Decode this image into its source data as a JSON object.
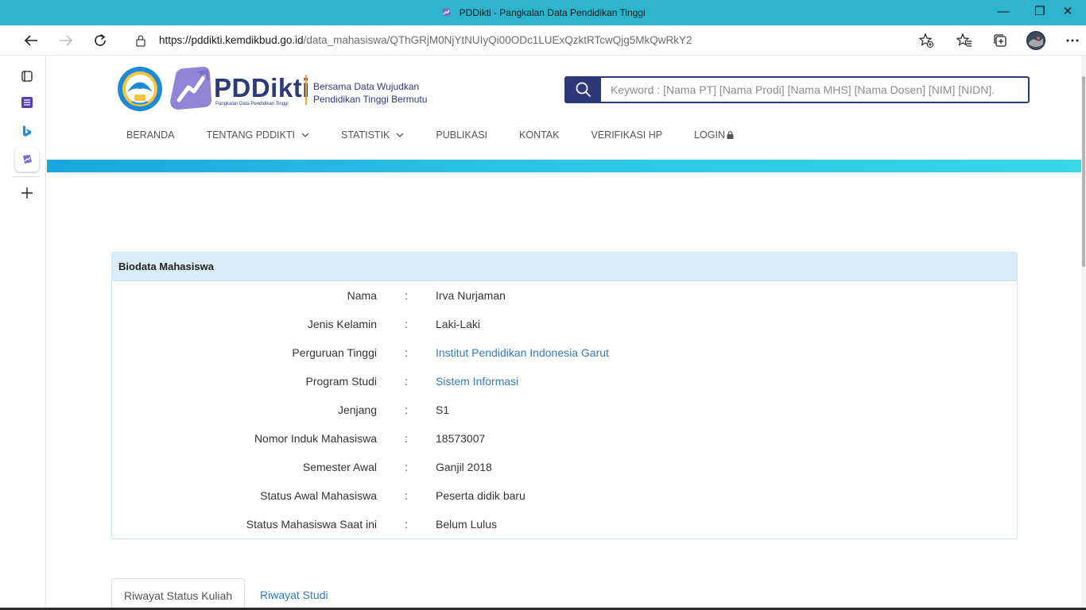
{
  "window": {
    "title": "PDDikti - Pangkalan Data Pendidikan Tinggi",
    "controls": {
      "minimize": "—",
      "restore": "❐",
      "close": "✕"
    }
  },
  "browser": {
    "url_host": "https://pddikti.kemdikbud.go.id",
    "url_path": "/data_mahasiswa/QThGRjM0NjYtNUIyQi00ODc1LUExQzktRTcwQjg5MkQwRkY2",
    "icons": [
      "back-icon",
      "forward-icon",
      "refresh-icon",
      "lock-icon",
      "add-favorite-icon",
      "favorites-icon",
      "collections-icon",
      "profile-avatar",
      "more-icon"
    ]
  },
  "sidebar": {
    "icons": [
      "tabs-icon",
      "list-app-icon",
      "bing-icon",
      "pddikti-app-icon",
      "add-icon"
    ]
  },
  "header": {
    "brand": "PDDikti",
    "brand_sub": "Pangkalan Data Pendidikan Tinggi",
    "tagline_line1": "Bersama Data Wujudkan",
    "tagline_line2": "Pendidikan Tinggi Bermutu",
    "search_placeholder": "Keyword :  [Nama PT] [Nama Prodi] [Nama MHS] [Nama Dosen] [NIM] [NIDN]."
  },
  "menu": {
    "items": [
      "BERANDA",
      "TENTANG PDDIKTI",
      "STATISTIK",
      "PUBLIKASI",
      "KONTAK",
      "VERIFIKASI HP",
      "LOGIN"
    ]
  },
  "biodata": {
    "title": "Biodata Mahasiswa",
    "rows": [
      {
        "label": "Nama",
        "value": "Irva Nurjaman"
      },
      {
        "label": "Jenis Kelamin",
        "value": "Laki-Laki"
      },
      {
        "label": "Perguruan Tinggi",
        "value": "Institut Pendidikan Indonesia Garut"
      },
      {
        "label": "Program Studi",
        "value": "Sistem Informasi"
      },
      {
        "label": "Jenjang",
        "value": "S1"
      },
      {
        "label": "Nomor Induk Mahasiswa",
        "value": "18573007"
      },
      {
        "label": "Semester Awal",
        "value": "Ganjil 2018"
      },
      {
        "label": "Status Awal Mahasiswa",
        "value": "Peserta didik baru"
      },
      {
        "label": "Status Mahasiswa Saat ini",
        "value": "Belum Lulus"
      }
    ],
    "colon": ":"
  },
  "tabs": {
    "items": [
      "Riwayat Status Kuliah",
      "Riwayat Studi"
    ]
  },
  "colors": {
    "titlebar": "#2eb4cc",
    "brand_navy": "#2e3a78",
    "link": "#337ab7",
    "card_header": "#d9edf7"
  }
}
